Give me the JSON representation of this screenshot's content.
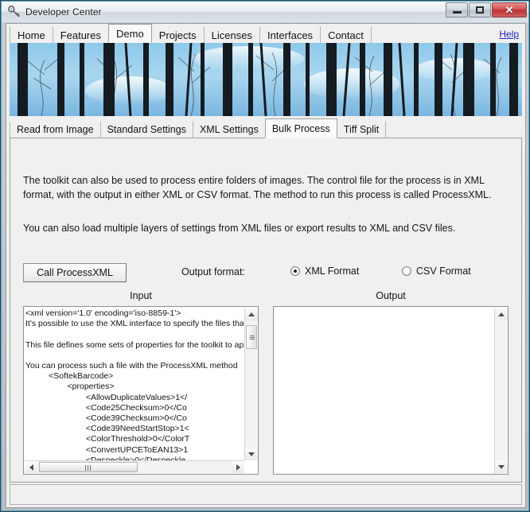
{
  "window": {
    "title": "Developer Center",
    "icon": "key-icon",
    "buttons": {
      "minimize": "minimize-button",
      "maximize": "maximize-button",
      "close": "✕"
    },
    "accent_color": "#29a8d0"
  },
  "main_tabs": [
    {
      "label": "Home",
      "active": false
    },
    {
      "label": "Features",
      "active": false
    },
    {
      "label": "Demo",
      "active": true
    },
    {
      "label": "Projects",
      "active": false
    },
    {
      "label": "Licenses",
      "active": false
    },
    {
      "label": "Interfaces",
      "active": false
    },
    {
      "label": "Contact",
      "active": false
    }
  ],
  "help_link": "Help",
  "banner": {
    "alt": "forest-banner-image",
    "sky_color": "#87c4e8",
    "tree_color": "#131a20"
  },
  "sub_tabs": [
    {
      "label": "Read from Image",
      "active": false
    },
    {
      "label": "Standard Settings",
      "active": false
    },
    {
      "label": "XML Settings",
      "active": false
    },
    {
      "label": "Bulk Process",
      "active": true
    },
    {
      "label": "Tiff Split",
      "active": false
    }
  ],
  "panel": {
    "paragraph1": "The toolkit can also be used to process entire folders of images. The control file for the\nprocess is in XML format, with the output in either XML or CSV format. The method to run\nthis process is called ProcessXML.",
    "paragraph2": "You can also load  multiple layers of settings from XML files or export results to XML and\nCSV files.",
    "call_button": "Call ProcessXML",
    "output_format_label": "Output format:",
    "radios": [
      {
        "label": "XML Format",
        "selected": true
      },
      {
        "label": "CSV Format",
        "selected": false
      }
    ],
    "input_header": "Input",
    "output_header": "Output",
    "input_text": "<xml version='1.0' encoding='iso-8859-1'>\nIt's possible to use the XML interface to specify the files tha\n\nThis file defines some sets of properties for the toolkit to ap\n\nYou can process such a file with the ProcessXML method\n          <SoftekBarcode>\n                  <properties>\n                          <AllowDuplicateValues>1</\n                          <Code25Checksum>0</Co\n                          <Code39Checksum>0</Co\n                          <Code39NeedStartStop>1<\n                          <ColorThreshold>0</ColorT\n                          <ConvertUPCEToEAN13>1\n                          <Despeckle>0</Despeckle",
    "output_text": ""
  },
  "statusbar": {
    "text": ""
  }
}
